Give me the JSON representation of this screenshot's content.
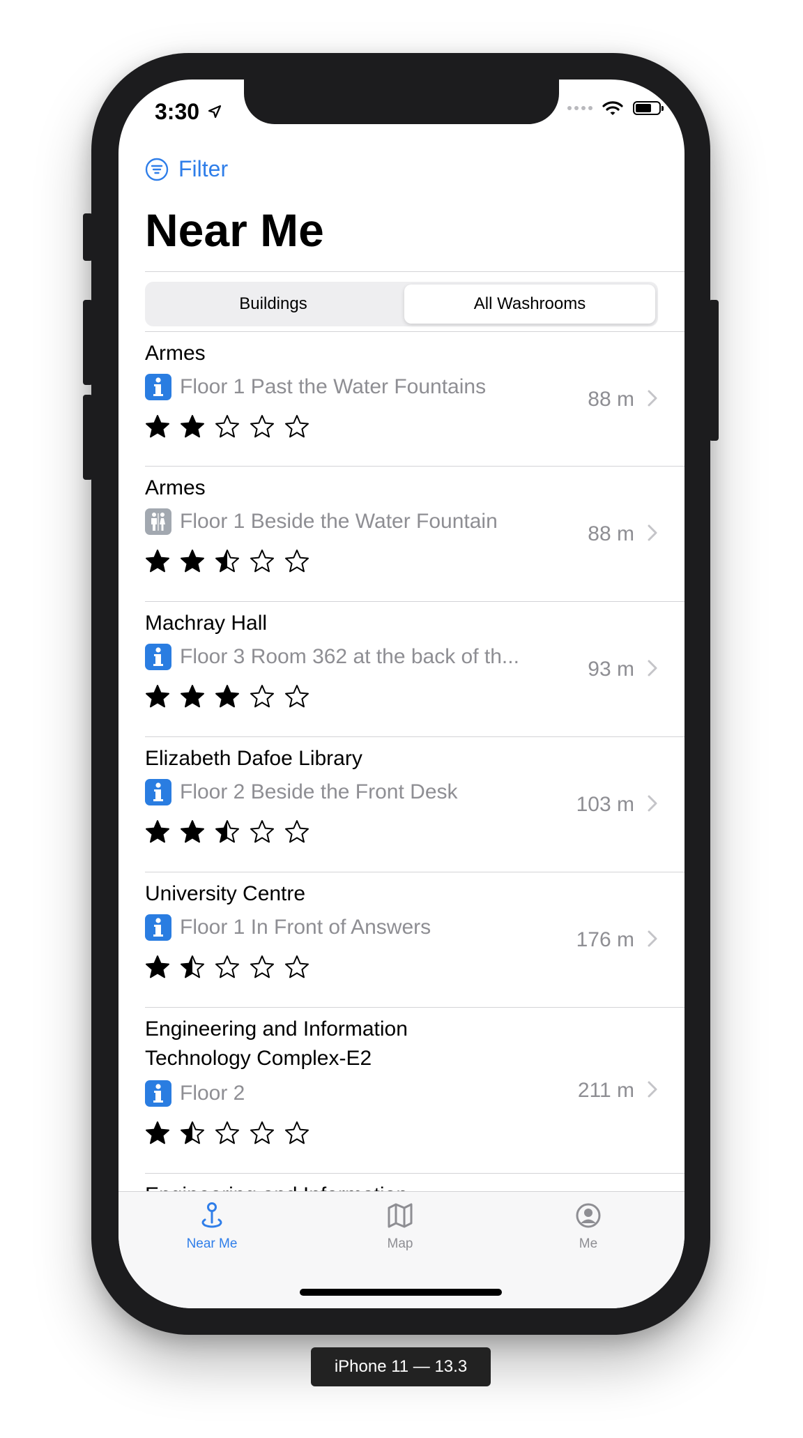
{
  "status": {
    "time": "3:30"
  },
  "nav": {
    "filter_label": "Filter",
    "title": "Near Me"
  },
  "segmented": {
    "left": "Buildings",
    "right": "All Washrooms",
    "selected": "All Washrooms"
  },
  "rows": [
    {
      "name": "Armes",
      "location": "Floor 1 Past the Water Fountains",
      "icon": "info-icon",
      "distance": "88 m",
      "rating": 2
    },
    {
      "name": "Armes",
      "location": "Floor 1 Beside the Water Fountain",
      "icon": "restroom-icon",
      "distance": "88 m",
      "rating": 2.5
    },
    {
      "name": "Machray Hall",
      "location": "Floor 3 Room 362 at the back of th...",
      "icon": "info-icon",
      "distance": "93 m",
      "rating": 3
    },
    {
      "name": "Elizabeth Dafoe Library",
      "location": "Floor 2 Beside the Front Desk",
      "icon": "info-icon",
      "distance": "103 m",
      "rating": 2.5
    },
    {
      "name": "University Centre",
      "location": "Floor 1 In Front of Answers",
      "icon": "info-icon",
      "distance": "176 m",
      "rating": 1.5
    },
    {
      "name": "Engineering and Information Technology Complex-E2",
      "location": "Floor 2",
      "icon": "info-icon",
      "distance": "211 m",
      "rating": 1.5
    },
    {
      "name": "Engineering and Information",
      "partial": true
    }
  ],
  "tabs": [
    {
      "label": "Near Me",
      "icon": "pin-icon",
      "active": true
    },
    {
      "label": "Map",
      "icon": "map-icon",
      "active": false
    },
    {
      "label": "Me",
      "icon": "person-circle-icon",
      "active": false
    }
  ],
  "device_caption": "iPhone 11 — 13.3",
  "colors": {
    "accent": "#2f7ee9",
    "secondary_text": "#8e8e93",
    "info_icon": "#2a7de1",
    "restroom_icon": "#a2a8b0"
  }
}
